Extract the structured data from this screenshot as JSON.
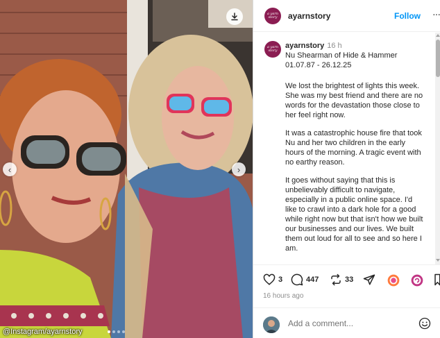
{
  "photo": {
    "credit": "@Instagram/ayarnstory",
    "carousel_count": 4,
    "carousel_active": 1,
    "prev_icon": "chevron-left-icon",
    "next_icon": "chevron-right-icon",
    "save_icon": "download-icon"
  },
  "header": {
    "username": "ayarnstory",
    "follow_label": "Follow",
    "more_label": "···",
    "avatar_text": "a yarn story"
  },
  "caption": {
    "username": "ayarnstory",
    "time": "16 h",
    "line1": "Nu Shearman of Hide & Hammer",
    "line2": "01.07.87 - 26.12.25",
    "paragraphs": [
      "We lost the brightest of lights this week. She was my best friend and there are no words for the devastation those close to her feel right now.",
      "It was a catastrophic house fire that took Nu and her two children in the early hours of the morning. A tragic event with no earthy reason.",
      "It goes without saying that this is unbelievably difficult to navigate, especially in a public online space. I'd like to crawl into a dark hole for a good while right now but that isn't how we built our businesses and our lives. We built them out loud for all to see and so here I am."
    ]
  },
  "actions": {
    "likes": "3",
    "comments": "447",
    "reposts": "33",
    "time_ago": "16 hours ago"
  },
  "comment": {
    "placeholder": "Add a comment..."
  },
  "colors": {
    "accent": "#0095f6",
    "brand": "#8b1d52",
    "muted": "#8e8e8e"
  }
}
